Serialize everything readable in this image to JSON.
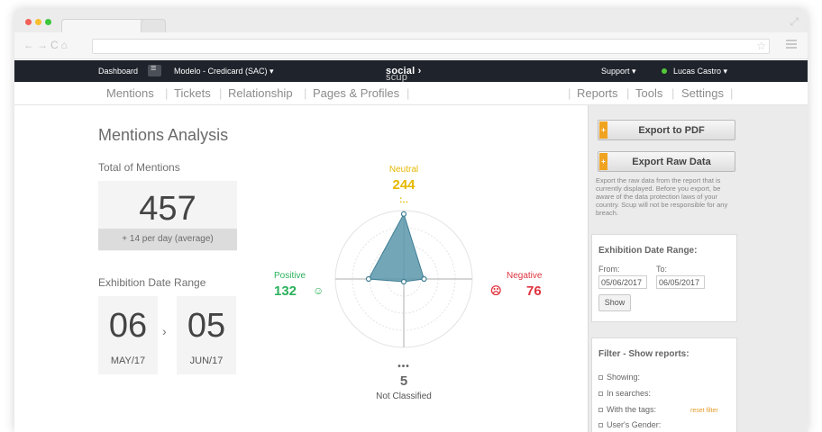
{
  "topnav": {
    "dashboard": "Dashboard",
    "account": "Modelo - Credicard (SAC) ▾",
    "brand_light": "scup",
    "brand_bold": "social",
    "brand_mark": "›",
    "support": "Support ▾",
    "user": "Lucas Castro ▾"
  },
  "subnav": {
    "left": [
      "Mentions",
      "Tickets",
      "Relationship",
      "Pages & Profiles"
    ],
    "right": [
      "Reports",
      "Tools",
      "Settings"
    ]
  },
  "main": {
    "title": "Mentions Analysis",
    "total_label": "Total of Mentions",
    "total_value": "457",
    "total_avg": "+ 14 per day (average)",
    "date_range_label": "Exhibition Date Range",
    "from_day": "06",
    "from_month": "MAY/17",
    "to_day": "05",
    "to_month": "JUN/17",
    "arrow": "›"
  },
  "chart_data": {
    "type": "radar",
    "categories": [
      "Neutral",
      "Negative",
      "Not Classified",
      "Positive"
    ],
    "values": [
      244,
      76,
      5,
      132
    ],
    "faces": {
      "neutral": ":‥",
      "positive": "☺",
      "negative": "☹",
      "not_classified": "•••"
    }
  },
  "sidebar": {
    "export_pdf": "Export to PDF",
    "export_raw": "Export Raw Data",
    "plus": "+",
    "note": "Export the raw data from the report that is currently displayed. Before you export, be aware of the data protection laws of your country. Scup will not be responsible for any breach.",
    "date_panel": {
      "title": "Exhibition Date Range:",
      "from_label": "From:",
      "to_label": "To:",
      "from_value": "05/06/2017",
      "to_value": "06/05/2017",
      "show": "Show"
    },
    "filter_panel": {
      "title": "Filter - Show reports:",
      "items": [
        "Showing:",
        "In searches:",
        "With the tags:",
        "User's Gender:"
      ],
      "reset": "reset filter"
    }
  },
  "colors": {
    "neutral": "#e6b800",
    "positive": "#2bb15c",
    "negative": "#e0343f",
    "radar_fill": "#5b98ac"
  }
}
